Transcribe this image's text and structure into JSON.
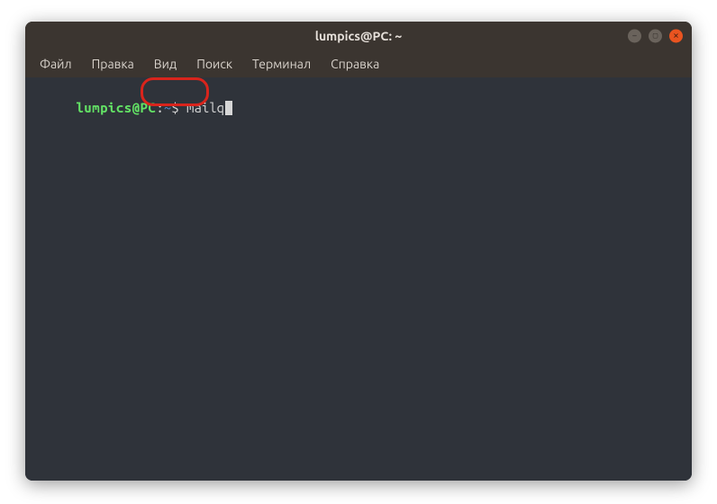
{
  "titlebar": {
    "title": "lumpics@PC: ~"
  },
  "menu": {
    "file": "Файл",
    "edit": "Правка",
    "view": "Вид",
    "search": "Поиск",
    "terminal": "Терминал",
    "help": "Справка"
  },
  "prompt": {
    "user_host": "lumpics@PC",
    "colon": ":",
    "path": "~",
    "symbol": "$ ",
    "command": "mailq"
  },
  "window_controls": {
    "minimize": "minimize",
    "maximize": "maximize",
    "close": "close"
  },
  "annotation": {
    "highlighted_command": "mailq"
  }
}
